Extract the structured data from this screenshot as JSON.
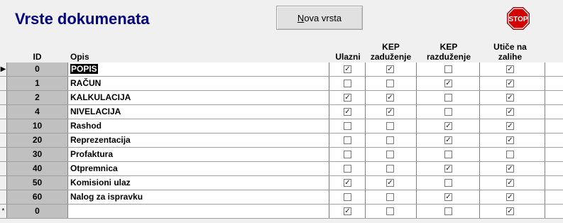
{
  "title": "Vrste dokumenata",
  "nova_button": {
    "underlined": "N",
    "rest": "ova vrsta"
  },
  "stop_button": {
    "label": "STOP",
    "icon": "stop-sign-icon",
    "color": "#cc0000"
  },
  "columns": {
    "id": "ID",
    "opis": "Opis",
    "ulazni": "Ulazni",
    "kep_zaduzenje": [
      "KEP",
      "zaduženje"
    ],
    "kep_razduzenje": [
      "KEP",
      "razduženje"
    ],
    "utice": [
      "Utiče na",
      "zalihe"
    ]
  },
  "rows": [
    {
      "id": "0",
      "opis": "POPIS",
      "ulazni": true,
      "kep_z": true,
      "kep_r": false,
      "utice": true
    },
    {
      "id": "1",
      "opis": "RAČUN",
      "ulazni": false,
      "kep_z": false,
      "kep_r": true,
      "utice": true
    },
    {
      "id": "2",
      "opis": "KALKULACIJA",
      "ulazni": true,
      "kep_z": true,
      "kep_r": false,
      "utice": true
    },
    {
      "id": "4",
      "opis": "NIVELACIJA",
      "ulazni": true,
      "kep_z": true,
      "kep_r": false,
      "utice": true
    },
    {
      "id": "10",
      "opis": "Rashod",
      "ulazni": false,
      "kep_z": false,
      "kep_r": true,
      "utice": true
    },
    {
      "id": "20",
      "opis": "Reprezentacija",
      "ulazni": false,
      "kep_z": false,
      "kep_r": true,
      "utice": true
    },
    {
      "id": "30",
      "opis": "Profaktura",
      "ulazni": false,
      "kep_z": false,
      "kep_r": false,
      "utice": false
    },
    {
      "id": "40",
      "opis": "Otpremnica",
      "ulazni": false,
      "kep_z": false,
      "kep_r": true,
      "utice": true
    },
    {
      "id": "50",
      "opis": "Komisioni ulaz",
      "ulazni": true,
      "kep_z": true,
      "kep_r": false,
      "utice": true
    },
    {
      "id": "60",
      "opis": "Nalog za ispravku",
      "ulazni": false,
      "kep_z": false,
      "kep_r": true,
      "utice": true
    },
    {
      "id": "0",
      "opis": "",
      "ulazni": true,
      "kep_z": false,
      "kep_r": false,
      "utice": true
    }
  ],
  "selector_marks": {
    "current": "▶",
    "new": "*"
  }
}
